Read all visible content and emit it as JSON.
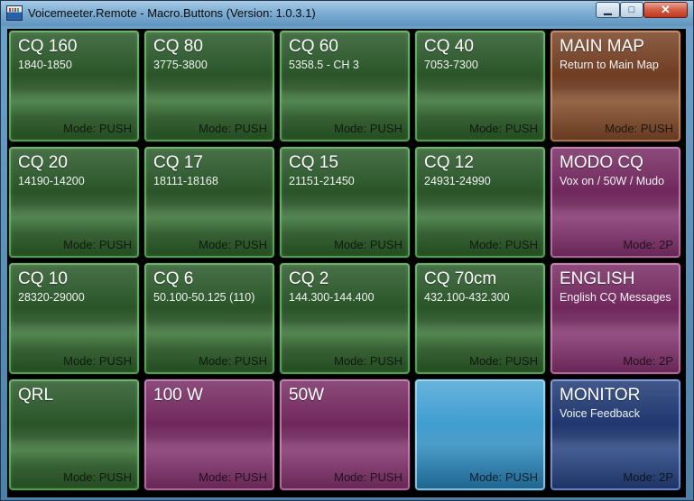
{
  "window": {
    "title": "Voicemeeter.Remote - Macro.Buttons (Version: 1.0.3.1)",
    "minimize_symbol": "▁",
    "maximize_symbol": "□",
    "close_symbol": "✕"
  },
  "buttons": [
    {
      "title": "CQ 160",
      "sub": "1840-1850",
      "mode": "Mode: PUSH",
      "color": "green"
    },
    {
      "title": "CQ 80",
      "sub": "3775-3800",
      "mode": "Mode: PUSH",
      "color": "green"
    },
    {
      "title": "CQ 60",
      "sub": "5358.5 - CH 3",
      "mode": "Mode: PUSH",
      "color": "green"
    },
    {
      "title": "CQ 40",
      "sub": "7053-7300",
      "mode": "Mode: PUSH",
      "color": "green"
    },
    {
      "title": "MAIN MAP",
      "sub": "Return to Main Map",
      "mode": "Mode: PUSH",
      "color": "brown"
    },
    {
      "title": "CQ 20",
      "sub": "14190-14200",
      "mode": "Mode: PUSH",
      "color": "green"
    },
    {
      "title": "CQ 17",
      "sub": "18111-18168",
      "mode": "Mode: PUSH",
      "color": "green"
    },
    {
      "title": "CQ 15",
      "sub": "21151-21450",
      "mode": "Mode: PUSH",
      "color": "green"
    },
    {
      "title": "CQ 12",
      "sub": "24931-24990",
      "mode": "Mode: PUSH",
      "color": "green"
    },
    {
      "title": "MODO CQ",
      "sub": "Vox on / 50W / Mudo",
      "mode": "Mode: 2P",
      "color": "magenta"
    },
    {
      "title": "CQ 10",
      "sub": "28320-29000",
      "mode": "Mode: PUSH",
      "color": "green"
    },
    {
      "title": "CQ 6",
      "sub": "50.100-50.125 (110)",
      "mode": "Mode: PUSH",
      "color": "green"
    },
    {
      "title": "CQ 2",
      "sub": "144.300-144.400",
      "mode": "Mode: PUSH",
      "color": "green"
    },
    {
      "title": "CQ 70cm",
      "sub": "432.100-432.300",
      "mode": "Mode: PUSH",
      "color": "green"
    },
    {
      "title": "ENGLISH",
      "sub": "English CQ Messages",
      "mode": "Mode: 2P",
      "color": "magenta"
    },
    {
      "title": "QRL",
      "sub": "",
      "mode": "Mode: PUSH",
      "color": "green"
    },
    {
      "title": "100 W",
      "sub": "",
      "mode": "Mode: PUSH",
      "color": "magenta"
    },
    {
      "title": "50W",
      "sub": "",
      "mode": "Mode: PUSH",
      "color": "magenta"
    },
    {
      "title": "",
      "sub": "",
      "mode": "Mode: PUSH",
      "color": "cyan"
    },
    {
      "title": "MONITOR",
      "sub": "Voice Feedback",
      "mode": "Mode: 2P",
      "color": "navy"
    }
  ]
}
